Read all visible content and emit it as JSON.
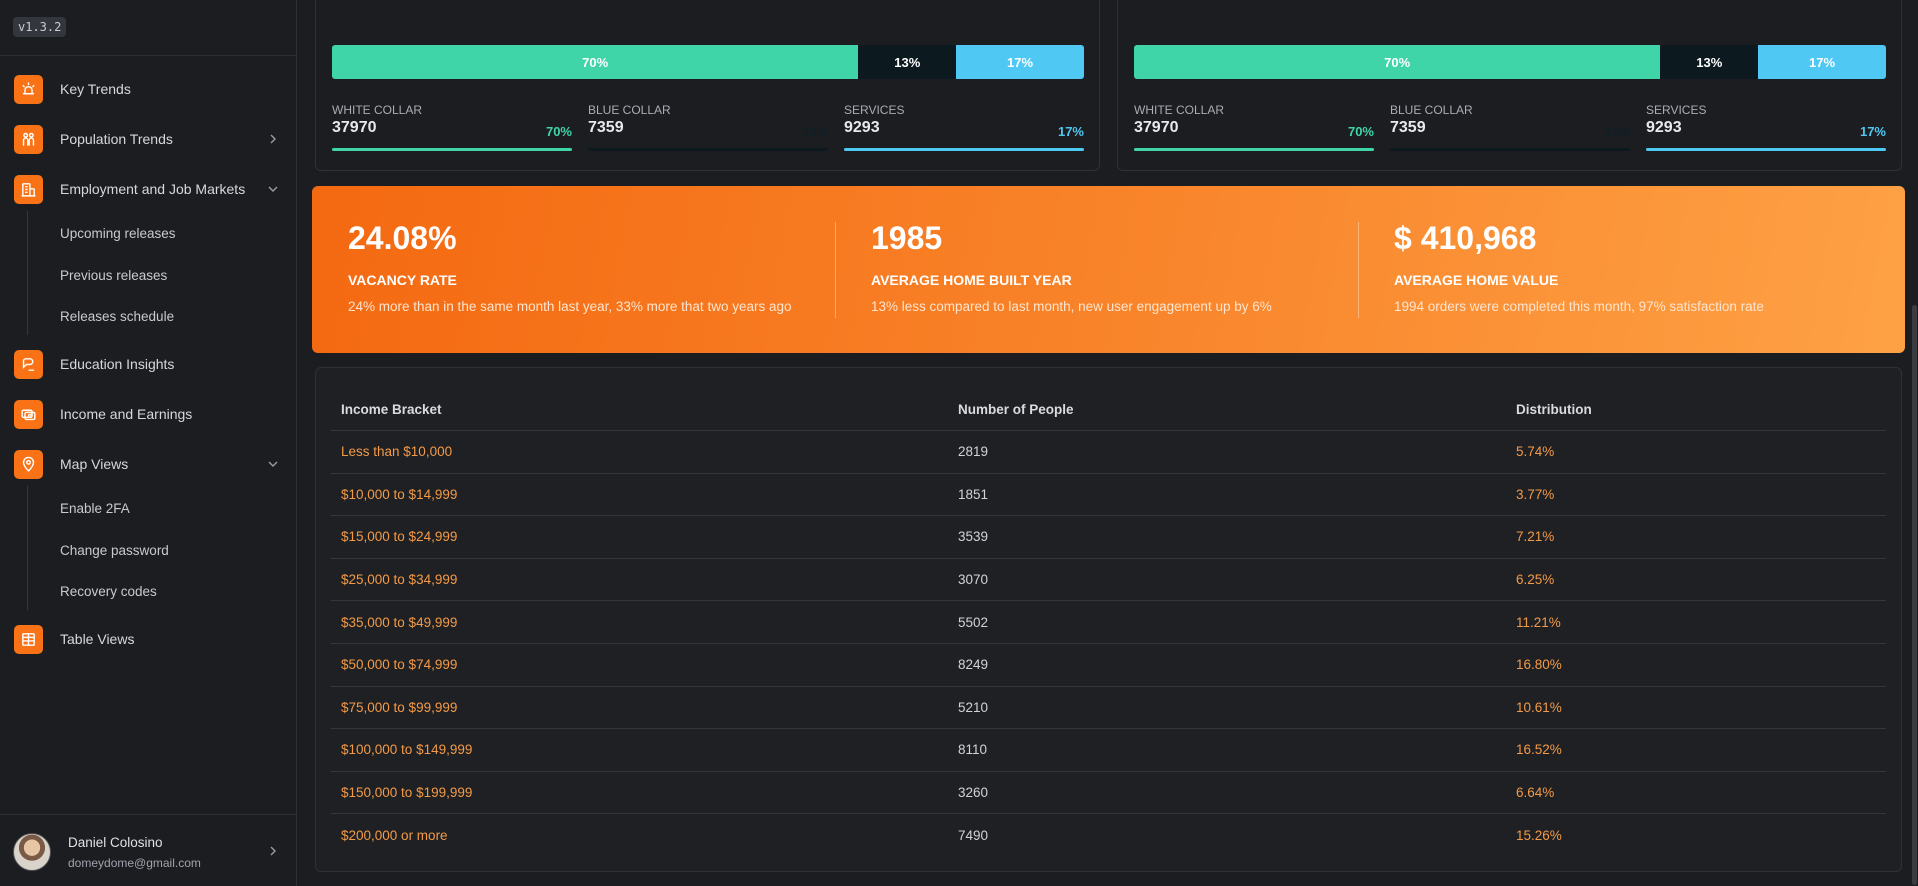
{
  "app": {
    "version": "v1.3.2"
  },
  "sidebar": {
    "items": [
      {
        "label": "Key Trends",
        "icon": "alarm-icon"
      },
      {
        "label": "Population Trends",
        "icon": "people-icon",
        "chevron": "right"
      },
      {
        "label": "Employment and Job Markets",
        "icon": "office-building-icon",
        "chevron": "down",
        "children": [
          "Upcoming releases",
          "Previous releases",
          "Releases schedule"
        ]
      },
      {
        "label": "Education Insights",
        "icon": "chat-bubble-icon"
      },
      {
        "label": "Income and Earnings",
        "icon": "money-icon"
      },
      {
        "label": "Map Views",
        "icon": "map-pin-icon",
        "chevron": "down",
        "children": [
          "Enable 2FA",
          "Change password",
          "Recovery codes"
        ]
      },
      {
        "label": "Table Views",
        "icon": "table-icon"
      }
    ],
    "user": {
      "name": "Daniel Colosino",
      "email": "domeydome@gmail.com"
    }
  },
  "workforce_cards": [
    {
      "segments": [
        {
          "label": "70%",
          "share": 70
        },
        {
          "label": "13%",
          "share": 13
        },
        {
          "label": "17%",
          "share": 17
        }
      ],
      "stats": [
        {
          "label": "WHITE COLLAR",
          "value": "37970",
          "pct": "70%"
        },
        {
          "label": "BLUE COLLAR",
          "value": "7359",
          "pct": "13%"
        },
        {
          "label": "SERVICES",
          "value": "9293",
          "pct": "17%"
        }
      ]
    },
    {
      "segments": [
        {
          "label": "70%",
          "share": 70
        },
        {
          "label": "13%",
          "share": 13
        },
        {
          "label": "17%",
          "share": 17
        }
      ],
      "stats": [
        {
          "label": "WHITE COLLAR",
          "value": "37970",
          "pct": "70%"
        },
        {
          "label": "BLUE COLLAR",
          "value": "7359",
          "pct": "13%"
        },
        {
          "label": "SERVICES",
          "value": "9293",
          "pct": "17%"
        }
      ]
    }
  ],
  "colors": {
    "accent": "#f97316",
    "white_collar": "#40d4a9",
    "blue_collar": "#0c1a20",
    "services": "#4fc8f4"
  },
  "metrics": [
    {
      "value": "24.08%",
      "label": "VACANCY RATE",
      "desc": "24% more than in the same month last year, 33% more that two years ago"
    },
    {
      "value": "1985",
      "label": "AVERAGE HOME BUILT YEAR",
      "desc": "13% less compared to last month, new user engagement up by 6%"
    },
    {
      "value": "$ 410,968",
      "label": "AVERAGE HOME VALUE",
      "desc": "1994 orders were completed this month, 97% satisfaction rate"
    }
  ],
  "income_table": {
    "headers": [
      "Income Bracket",
      "Number of People",
      "Distribution"
    ],
    "rows": [
      [
        "Less than $10,000",
        "2819",
        "5.74%"
      ],
      [
        "$10,000 to $14,999",
        "1851",
        "3.77%"
      ],
      [
        "$15,000 to $24,999",
        "3539",
        "7.21%"
      ],
      [
        "$25,000 to $34,999",
        "3070",
        "6.25%"
      ],
      [
        "$35,000 to $49,999",
        "5502",
        "11.21%"
      ],
      [
        "$50,000 to $74,999",
        "8249",
        "16.80%"
      ],
      [
        "$75,000 to $99,999",
        "5210",
        "10.61%"
      ],
      [
        "$100,000 to $149,999",
        "8110",
        "16.52%"
      ],
      [
        "$150,000 to $199,999",
        "3260",
        "6.64%"
      ],
      [
        "$200,000 or more",
        "7490",
        "15.26%"
      ]
    ]
  }
}
